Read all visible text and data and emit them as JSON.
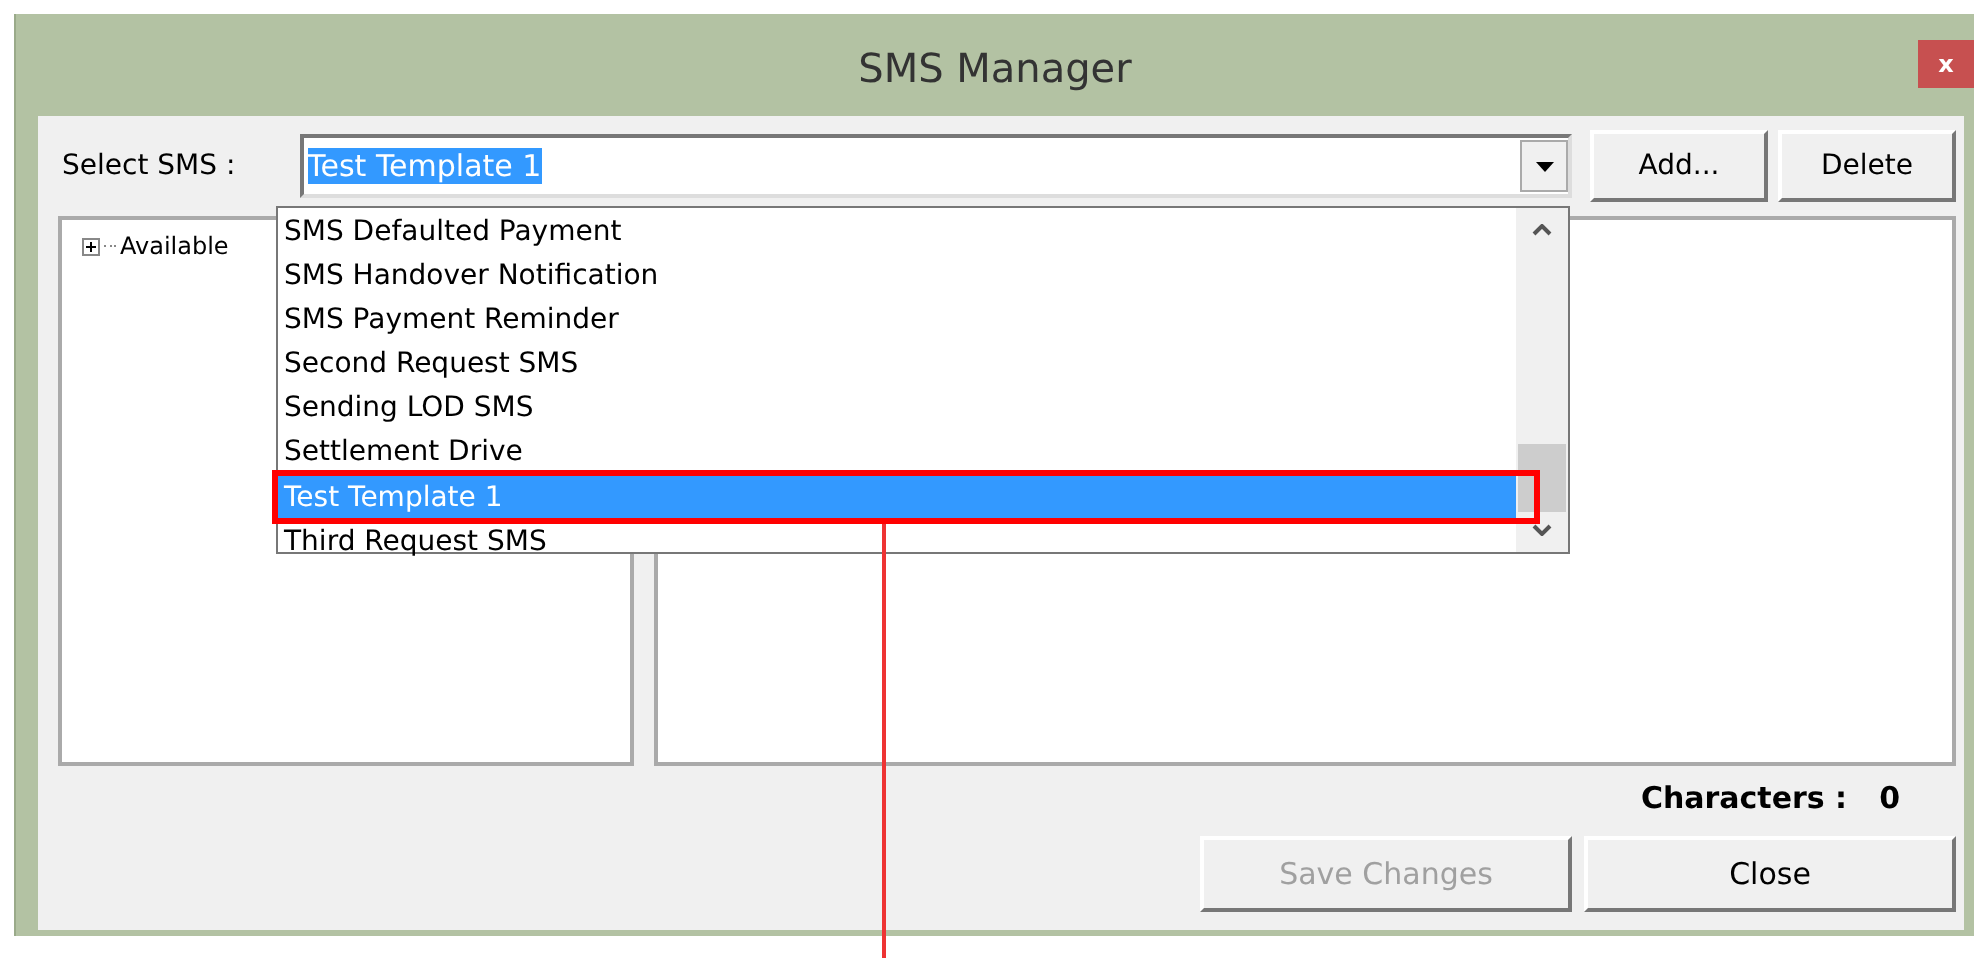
{
  "window": {
    "title": "SMS Manager",
    "close_label": "x"
  },
  "select_sms": {
    "label": "Select SMS :",
    "value": "Test Template 1",
    "expanded": true,
    "options": [
      {
        "label": "SMS Defaulted Payment",
        "selected": false
      },
      {
        "label": "SMS Handover Notification",
        "selected": false
      },
      {
        "label": "SMS Payment Reminder",
        "selected": false
      },
      {
        "label": "Second Request SMS",
        "selected": false
      },
      {
        "label": "Sending LOD SMS",
        "selected": false
      },
      {
        "label": "Settlement Drive",
        "selected": false
      },
      {
        "label": "Test Template 1",
        "selected": true
      },
      {
        "label": "Third Request SMS",
        "selected": false
      }
    ]
  },
  "buttons_top": [
    {
      "label": "Add...",
      "disabled": false
    },
    {
      "label": "Delete",
      "disabled": false
    }
  ],
  "tree": {
    "items": [
      {
        "label": "Available",
        "expanded": false
      }
    ]
  },
  "characters": {
    "label": "Characters :",
    "value": "0"
  },
  "buttons_bottom": [
    {
      "label": "Save Changes",
      "disabled": true
    },
    {
      "label": "Close",
      "disabled": false
    }
  ]
}
